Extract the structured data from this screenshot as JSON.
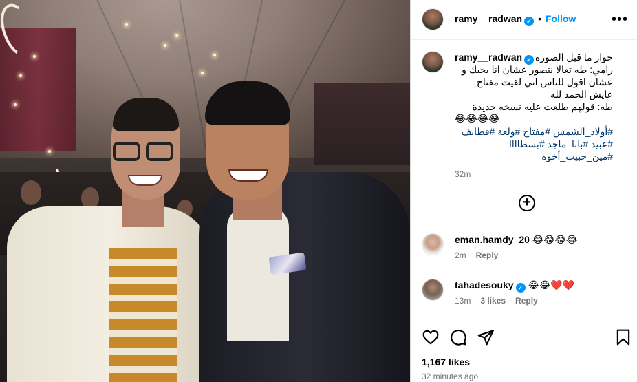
{
  "post": {
    "username": "ramy__radwan",
    "verified_mark": "✓",
    "dot": "•",
    "follow_label": "Follow",
    "more_label": "•••",
    "caption": {
      "username": "ramy__radwan",
      "text": "حوار ما قبل الصوره\nرامي: طه تعالا نتصور عشان انا بحبك و عشان اقول للناس اني لقيت مفتاح عايش الحمد لله\nطه: قولهم طلعت عليه نسخه جديدة",
      "emoji_line": "😂😂😂😂",
      "hashtags_line1": "#أولاد_الشمس #مفتاح #ولعة #قطايف",
      "hashtags_line2": "#عبيد #بابا_ماجد #بسطاااا",
      "hashtags_line3": "#مين_حبيب_أخوه",
      "time": "32m"
    },
    "load_more_icon": "+",
    "comments": [
      {
        "username": "eman.hamdy_20",
        "text": "😂😂😂😂",
        "time": "2m",
        "likes": "",
        "reply_label": "Reply",
        "verified": false
      },
      {
        "username": "tahadesouky",
        "text": "😂😂❤️❤️",
        "time": "13m",
        "likes": "3 likes",
        "reply_label": "Reply",
        "verified": true
      }
    ],
    "likes_count": "1,167 likes",
    "posted_time": "32 minutes ago"
  },
  "icons": {
    "like": "heart-icon",
    "comment": "comment-icon",
    "share": "share-icon",
    "save": "bookmark-icon"
  },
  "colors": {
    "accent": "#0095f6",
    "muted": "#737373",
    "hashtag": "#00376b"
  }
}
